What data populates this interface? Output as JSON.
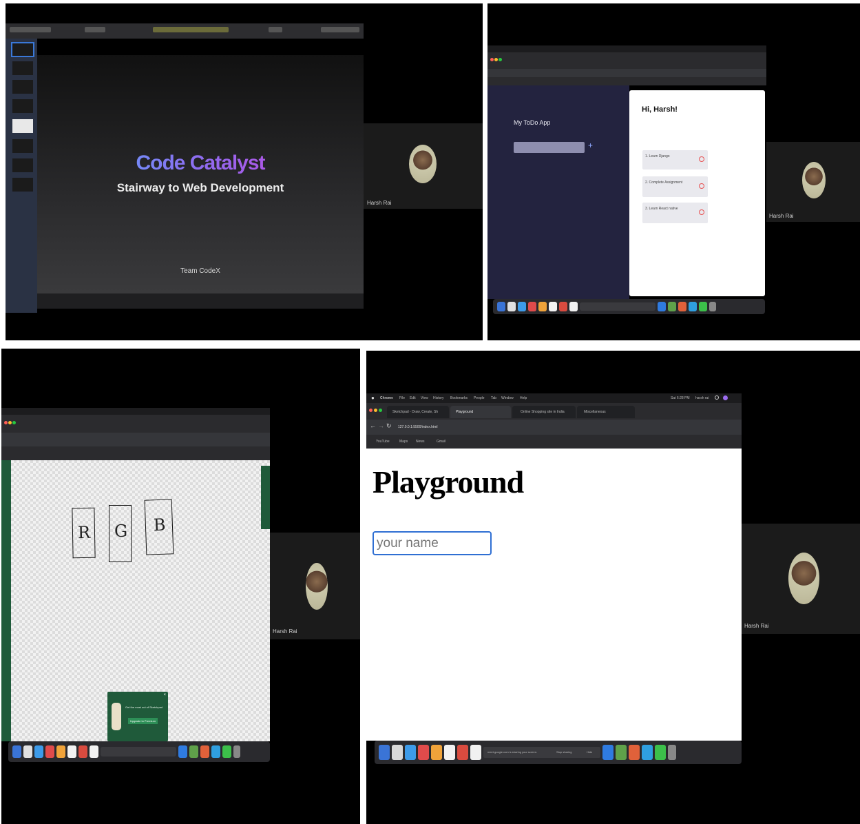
{
  "participant_name": "Harsh Rai",
  "panel1": {
    "slide_title": "Code Catalyst",
    "slide_subtitle": "Stairway to Web Development",
    "slide_footer": "Team CodeX"
  },
  "panel2": {
    "app_title": "My ToDo App",
    "add_button": "+",
    "greeting": "Hi, Harsh!",
    "tasks": [
      "1. Learn Django",
      "2. Complete Assignment",
      "3. Learn React native"
    ]
  },
  "panel3": {
    "drawing_letters": [
      "R",
      "G",
      "B"
    ],
    "promo_text": "Get the most out of Sketchpad",
    "promo_button": "Upgrade to Premium"
  },
  "panel4": {
    "menubar": [
      "Chrome",
      "File",
      "Edit",
      "View",
      "History",
      "Bookmarks",
      "People",
      "Tab",
      "Window",
      "Help"
    ],
    "clock": "Sat 6:28 PM",
    "user": "harsh rai",
    "tabs": [
      "Sketchpad - Draw, Create, Sh",
      "Playground",
      "Online Shopping site in India",
      "Miscellaneous"
    ],
    "address": "127.0.0.1:5500/index.html",
    "bookmarks": [
      "YouTube",
      "Maps",
      "News",
      "Gmail"
    ],
    "heading": "Playground",
    "input_placeholder": "your name",
    "share_notice": "meet.google.com is sharing your screen.",
    "stop_sharing": "Stop sharing",
    "hide": "Hide"
  },
  "colors": {
    "catalyst_gradient_start": "#4fb3ff",
    "catalyst_gradient_end": "#d63bd8",
    "todo_bg": "#23233f",
    "sketch_green": "#1f5a3a",
    "input_border": "#2f6fd3"
  }
}
